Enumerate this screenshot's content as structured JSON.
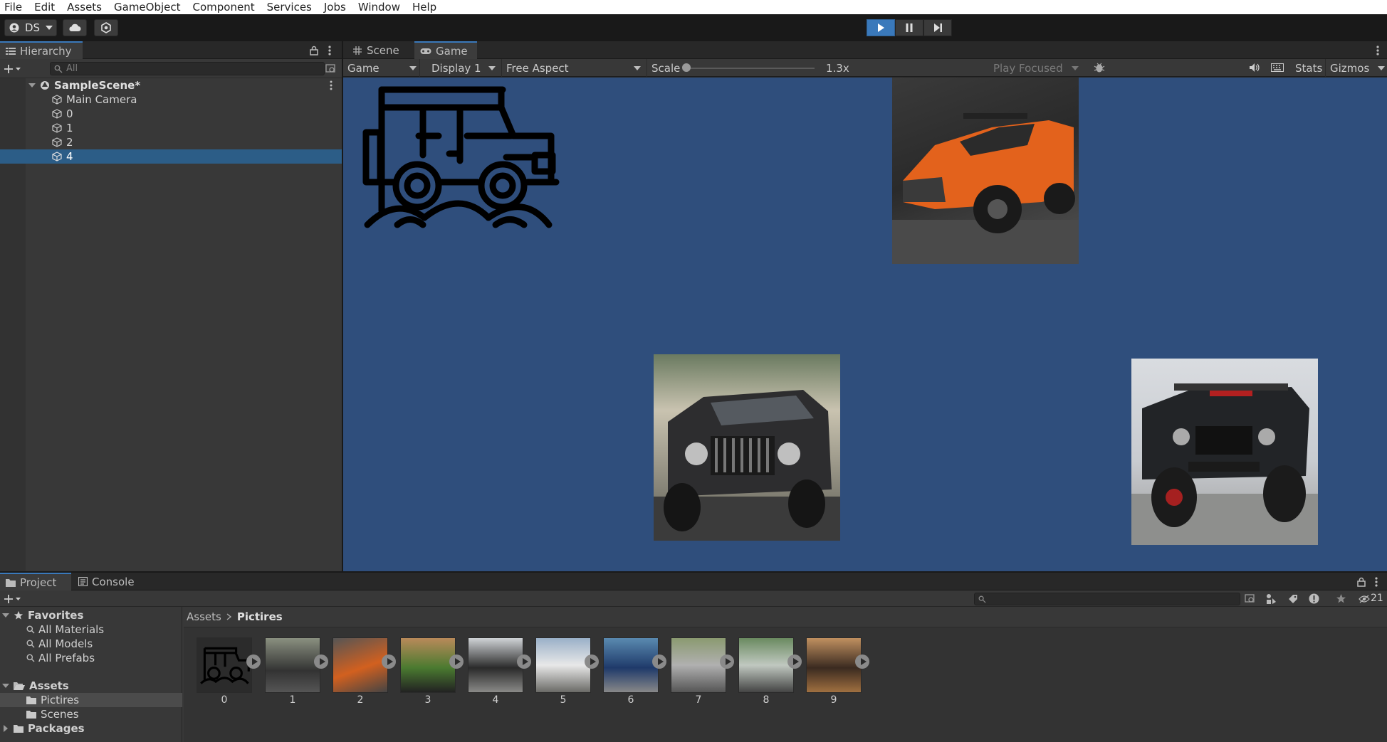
{
  "menu": [
    "File",
    "Edit",
    "Assets",
    "GameObject",
    "Component",
    "Services",
    "Jobs",
    "Window",
    "Help"
  ],
  "toolbar": {
    "account": "DS"
  },
  "hierarchy": {
    "tab": "Hierarchy",
    "search_placeholder": "All",
    "scene": "SampleScene*",
    "items": [
      "Main Camera",
      "0",
      "1",
      "2",
      "4"
    ],
    "selected": "4"
  },
  "game_tabs": {
    "scene": "Scene",
    "game": "Game"
  },
  "game_toolbar": {
    "mode": "Game",
    "display": "Display 1",
    "aspect": "Free Aspect",
    "scale_label": "Scale",
    "scale_value": "1.3x",
    "play_focused": "Play Focused",
    "stats": "Stats",
    "gizmos": "Gizmos"
  },
  "project": {
    "tab_project": "Project",
    "tab_console": "Console",
    "favorites": "Favorites",
    "favorite_items": [
      "All Materials",
      "All Models",
      "All Prefabs"
    ],
    "assets": "Assets",
    "asset_folders": [
      "Pictires",
      "Scenes"
    ],
    "packages": "Packages",
    "breadcrumb_root": "Assets",
    "breadcrumb_current": "Pictires",
    "count": "21",
    "thumbs": [
      "0",
      "1",
      "2",
      "3",
      "4",
      "5",
      "6",
      "7",
      "8",
      "9"
    ]
  },
  "colors": {
    "game_bg": "#2f4e7c",
    "selection": "#2c5d87",
    "play_active": "#3a79bb"
  }
}
